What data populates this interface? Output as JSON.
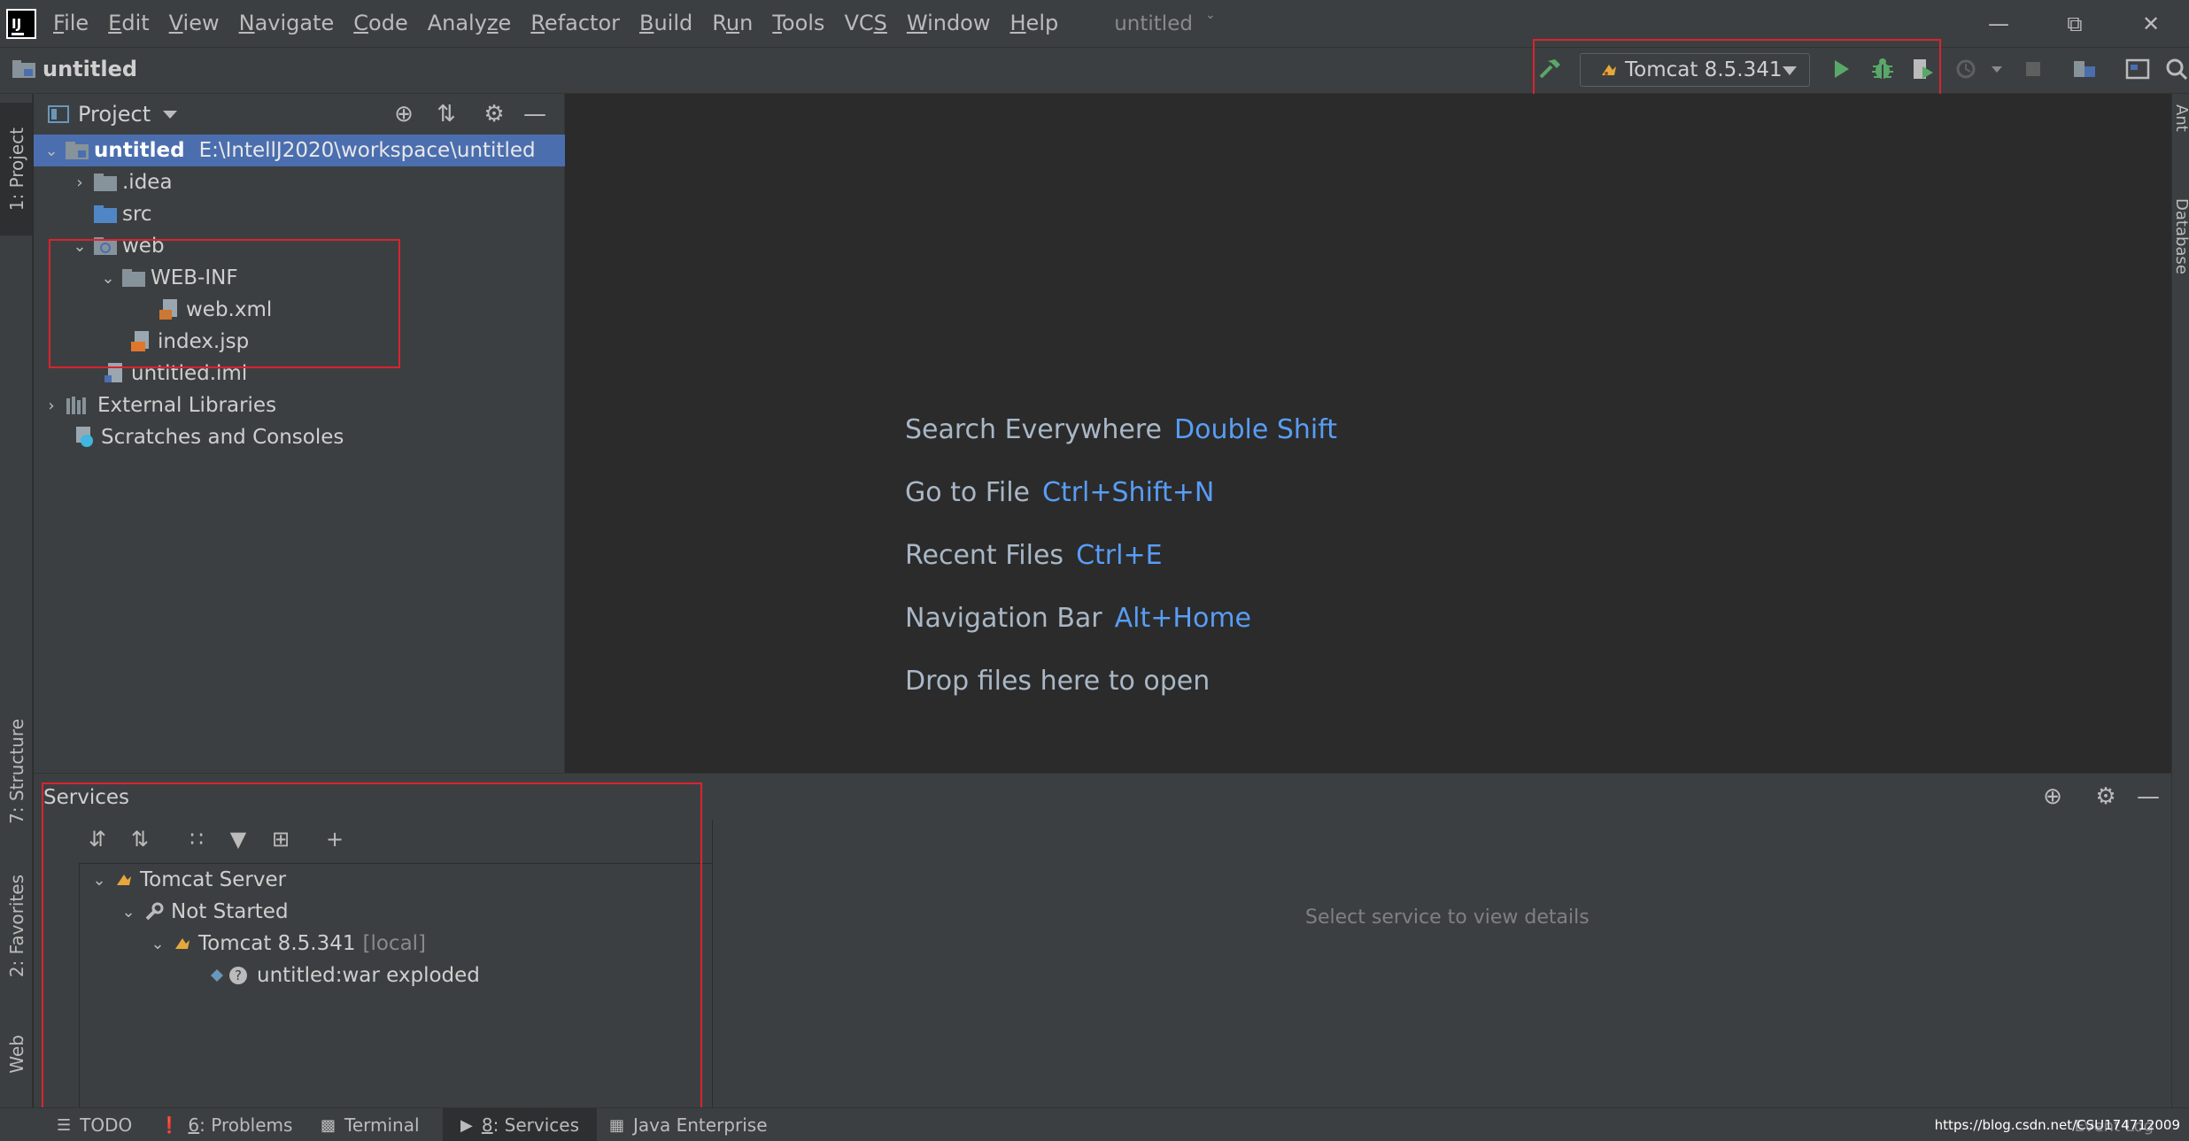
{
  "menu": {
    "items": [
      "File",
      "Edit",
      "View",
      "Navigate",
      "Code",
      "Analyze",
      "Refactor",
      "Build",
      "Run",
      "Tools",
      "VCS",
      "Window",
      "Help"
    ],
    "mnemonics": [
      "F",
      "E",
      "V",
      "N",
      "C",
      "z",
      "R",
      "B",
      "u",
      "T",
      "S",
      "W",
      "H"
    ],
    "window_title": "untitled"
  },
  "navbar": {
    "breadcrumb": "untitled",
    "run_config": "Tomcat 8.5.341"
  },
  "left_stripe": {
    "project_tab": "1: Project",
    "structure_tab": "7: Structure",
    "favorites_tab": "2: Favorites",
    "web_tab": "Web"
  },
  "right_stripe": {
    "ant_tab": "Ant",
    "database_tab": "Database"
  },
  "project_panel": {
    "title": "Project",
    "root": {
      "label": "untitled",
      "path": "E:\\IntellJ2020\\workspace\\untitled"
    },
    "items": {
      "idea": ".idea",
      "src": "src",
      "web": "web",
      "webinf": "WEB-INF",
      "webxml": "web.xml",
      "indexjsp": "index.jsp",
      "iml": "untitled.iml",
      "extlibs": "External Libraries",
      "scratches": "Scratches and Consoles"
    }
  },
  "editor": {
    "hints": [
      {
        "label": "Search Everywhere",
        "key": "Double Shift"
      },
      {
        "label": "Go to File",
        "key": "Ctrl+Shift+N"
      },
      {
        "label": "Recent Files",
        "key": "Ctrl+E"
      },
      {
        "label": "Navigation Bar",
        "key": "Alt+Home"
      },
      {
        "label": "Drop files here to open",
        "key": ""
      }
    ]
  },
  "services": {
    "title": "Services",
    "tree": {
      "server": "Tomcat Server",
      "status": "Not Started",
      "instance": "Tomcat 8.5.341",
      "instance_suffix": "[local]",
      "artifact": "untitled:war exploded"
    },
    "details_placeholder": "Select service to view details"
  },
  "bottom_tabs": {
    "todo": "TODO",
    "problems_num": "6",
    "problems": ": Problems",
    "terminal": "Terminal",
    "services_num": "8",
    "services": ": Services",
    "java_enterprise": "Java Enterprise",
    "event_log": "Event Log",
    "watermark": "https://blog.csdn.net/CSU174712009"
  },
  "colors": {
    "background": "#2b2b2b",
    "panel": "#3c3f41",
    "selection": "#4b6eaf",
    "highlight_box": "#d9242f",
    "shortcut_key": "#589df6",
    "run_green": "#59a869",
    "folder_blue": "#87939a"
  }
}
